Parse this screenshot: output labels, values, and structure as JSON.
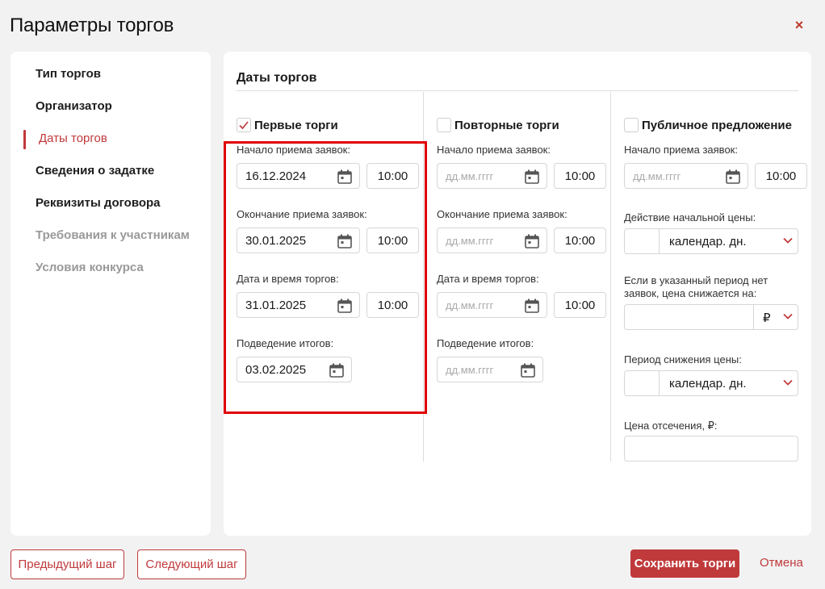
{
  "dialog": {
    "title": "Параметры торгов",
    "close_glyph": "×"
  },
  "sidebar": {
    "items": [
      {
        "label": "Тип торгов"
      },
      {
        "label": "Организатор"
      },
      {
        "label": "Даты торгов"
      },
      {
        "label": "Сведения о задатке"
      },
      {
        "label": "Реквизиты договора"
      },
      {
        "label": "Требования к участникам"
      },
      {
        "label": "Условия конкурса"
      }
    ],
    "active_index": 2
  },
  "main": {
    "section_title": "Даты торгов",
    "first": {
      "checkbox_label": "Первые торги",
      "checked": true,
      "start_label": "Начало приема заявок:",
      "start_date": "16.12.2024",
      "start_time": "10:00",
      "end_label": "Окончание приема заявок:",
      "end_date": "30.01.2025",
      "end_time": "10:00",
      "auction_label": "Дата и время торгов:",
      "auction_date": "31.01.2025",
      "auction_time": "10:00",
      "results_label": "Подведение итогов:",
      "results_date": "03.02.2025"
    },
    "repeat": {
      "checkbox_label": "Повторные торги",
      "checked": false,
      "start_label": "Начало приема заявок:",
      "date_placeholder": "дд.мм.гггг",
      "start_time": "10:00",
      "end_label": "Окончание приема заявок:",
      "end_time": "10:00",
      "auction_label": "Дата и время торгов:",
      "auction_time": "10:00",
      "results_label": "Подведение итогов:"
    },
    "public": {
      "checkbox_label": "Публичное предложение",
      "checked": false,
      "start_label": "Начало приема заявок:",
      "date_placeholder": "дд.мм.гггг",
      "start_time": "10:00",
      "initial_price_label": "Действие начальной цены:",
      "initial_price_unit": "календар. дн.",
      "decrease_label_line1": "Если в указанный период нет",
      "decrease_label_line2": "заявок, цена снижается на:",
      "decrease_currency": "₽",
      "period_label": "Период снижения цены:",
      "period_unit": "календар. дн.",
      "cutoff_label": "Цена отсечения, ₽:"
    }
  },
  "footer": {
    "prev_label": "Предыдущий шаг",
    "next_label": "Следующий шаг",
    "save_label": "Сохранить торги",
    "cancel_label": "Отмена"
  },
  "colors": {
    "accent": "#c0393b",
    "highlight": "#e00000"
  }
}
